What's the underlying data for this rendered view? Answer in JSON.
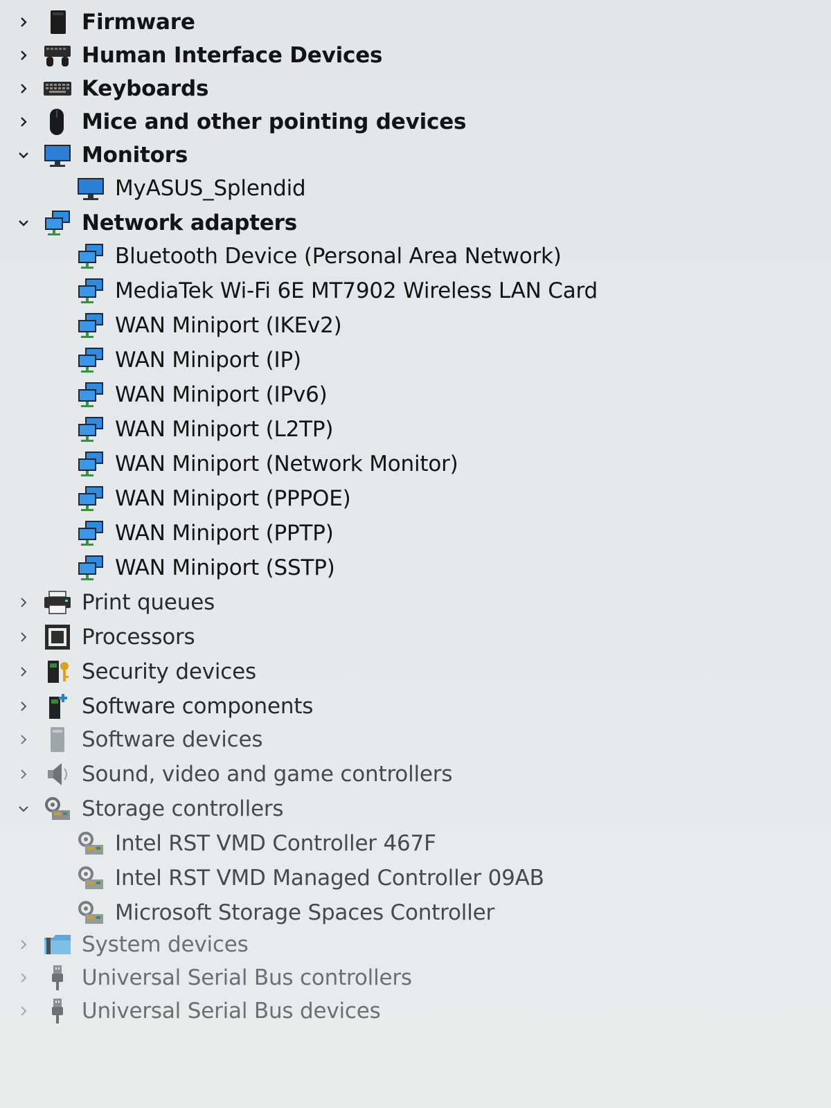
{
  "tree": {
    "categories": [
      {
        "label": "Firmware",
        "icon": "firmware-icon",
        "expanded": false
      },
      {
        "label": "Human Interface Devices",
        "icon": "hid-icon",
        "expanded": false
      },
      {
        "label": "Keyboards",
        "icon": "keyboard-icon",
        "expanded": false
      },
      {
        "label": "Mice and other pointing devices",
        "icon": "mouse-icon",
        "expanded": false
      },
      {
        "label": "Monitors",
        "icon": "monitor-icon",
        "expanded": true,
        "children": [
          {
            "label": "MyASUS_Splendid",
            "icon": "monitor-icon"
          }
        ]
      },
      {
        "label": "Network adapters",
        "icon": "network-adapter-icon",
        "expanded": true,
        "children": [
          {
            "label": "Bluetooth Device (Personal Area Network)",
            "icon": "network-adapter-icon"
          },
          {
            "label": "MediaTek Wi-Fi 6E MT7902 Wireless LAN Card",
            "icon": "network-adapter-icon"
          },
          {
            "label": "WAN Miniport (IKEv2)",
            "icon": "network-adapter-icon"
          },
          {
            "label": "WAN Miniport (IP)",
            "icon": "network-adapter-icon"
          },
          {
            "label": "WAN Miniport (IPv6)",
            "icon": "network-adapter-icon"
          },
          {
            "label": "WAN Miniport (L2TP)",
            "icon": "network-adapter-icon"
          },
          {
            "label": "WAN Miniport (Network Monitor)",
            "icon": "network-adapter-icon"
          },
          {
            "label": "WAN Miniport (PPPOE)",
            "icon": "network-adapter-icon"
          },
          {
            "label": "WAN Miniport (PPTP)",
            "icon": "network-adapter-icon"
          },
          {
            "label": "WAN Miniport (SSTP)",
            "icon": "network-adapter-icon"
          }
        ]
      },
      {
        "label": "Print queues",
        "icon": "printer-icon",
        "expanded": false
      },
      {
        "label": "Processors",
        "icon": "processor-icon",
        "expanded": false
      },
      {
        "label": "Security devices",
        "icon": "security-key-icon",
        "expanded": false
      },
      {
        "label": "Software components",
        "icon": "software-component-icon",
        "expanded": false
      },
      {
        "label": "Software devices",
        "icon": "software-device-icon",
        "expanded": false
      },
      {
        "label": "Sound, video and game controllers",
        "icon": "speaker-icon",
        "expanded": false
      },
      {
        "label": "Storage controllers",
        "icon": "storage-controller-icon",
        "expanded": true,
        "children": [
          {
            "label": "Intel RST VMD Controller 467F",
            "icon": "storage-controller-icon"
          },
          {
            "label": "Intel RST VMD Managed Controller 09AB",
            "icon": "storage-controller-icon"
          },
          {
            "label": "Microsoft Storage Spaces Controller",
            "icon": "storage-controller-icon"
          }
        ]
      },
      {
        "label": "System devices",
        "icon": "folder-icon",
        "expanded": false
      },
      {
        "label": "Universal Serial Bus controllers",
        "icon": "usb-icon",
        "expanded": false
      },
      {
        "label": "Universal Serial Bus devices",
        "icon": "usb-icon",
        "expanded": false
      }
    ]
  }
}
